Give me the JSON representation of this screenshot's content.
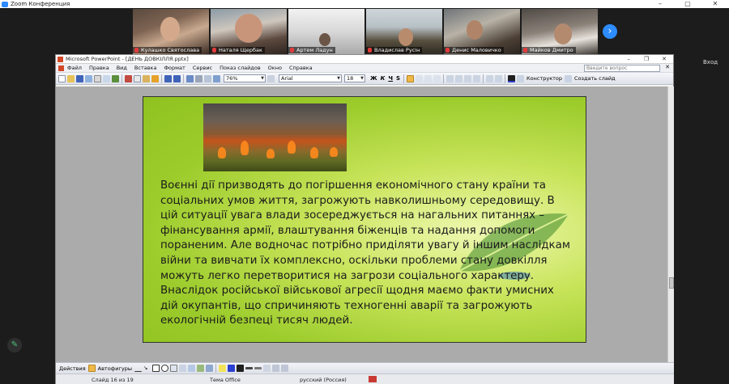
{
  "zoom": {
    "title": "Zoom Конференция",
    "minimize": "–",
    "maximize": "▢",
    "close": "✕",
    "next_arrow": "›",
    "side_label": "Вход",
    "participants": [
      {
        "name": "Кулашко Святослава"
      },
      {
        "name": "Наталя Щербак"
      },
      {
        "name": "Артем Ладун"
      },
      {
        "name": "Владислав Русін"
      },
      {
        "name": "Денис Маловичко"
      },
      {
        "name": "Майков Дмитро"
      }
    ]
  },
  "ppt": {
    "title": "Microsoft PowerPoint - [ДЕНЬ ДОВКІЛЛЯ.pptx]",
    "win_min": "–",
    "win_max": "❐",
    "win_close": "✕",
    "menu": [
      "Файл",
      "Правка",
      "Вид",
      "Вставка",
      "Формат",
      "Сервис",
      "Показ слайдов",
      "Окно",
      "Справка"
    ],
    "help_placeholder": "Введите вопрос",
    "menu_close": "✕",
    "zoom": "76%",
    "font": "Arial",
    "font_size": "18",
    "bold": "Ж",
    "italic": "К",
    "underline": "Ч",
    "shadow": "S",
    "designer": "Конструктор",
    "new_slide": "Создать слайд",
    "actions": "Действия",
    "autoshapes": "Автофигуры",
    "status_slide": "Слайд 16 из 19",
    "status_theme": "Тема Office",
    "status_lang": "русский (Россия)"
  },
  "slide": {
    "text": "Воєнні дії призводять до погіршення економічного стану країни та соціальних умов життя, загрожують навколишньому середовищу. В цій ситуації увага влади зосереджується на нагальних питаннях – фінансування армії, влаштування біженців та надання допомоги пораненим. Але водночас потрібно приділяти увагу й іншим наслідкам війни та вивчати їх комплексно, оскільки проблеми стану довкілля можуть легко перетворитися на загрози соціального характеру. Внаслідок російської військової агресії щодня маємо факти умисних дій окупантів, що спричиняють техногенні аварії та загрожують екологічній безпеці тисяч людей."
  },
  "colors": {
    "zoom_accent": "#2d8cff",
    "slide_green": "#9ccc2c",
    "mic_muted": "#e23b3b"
  }
}
